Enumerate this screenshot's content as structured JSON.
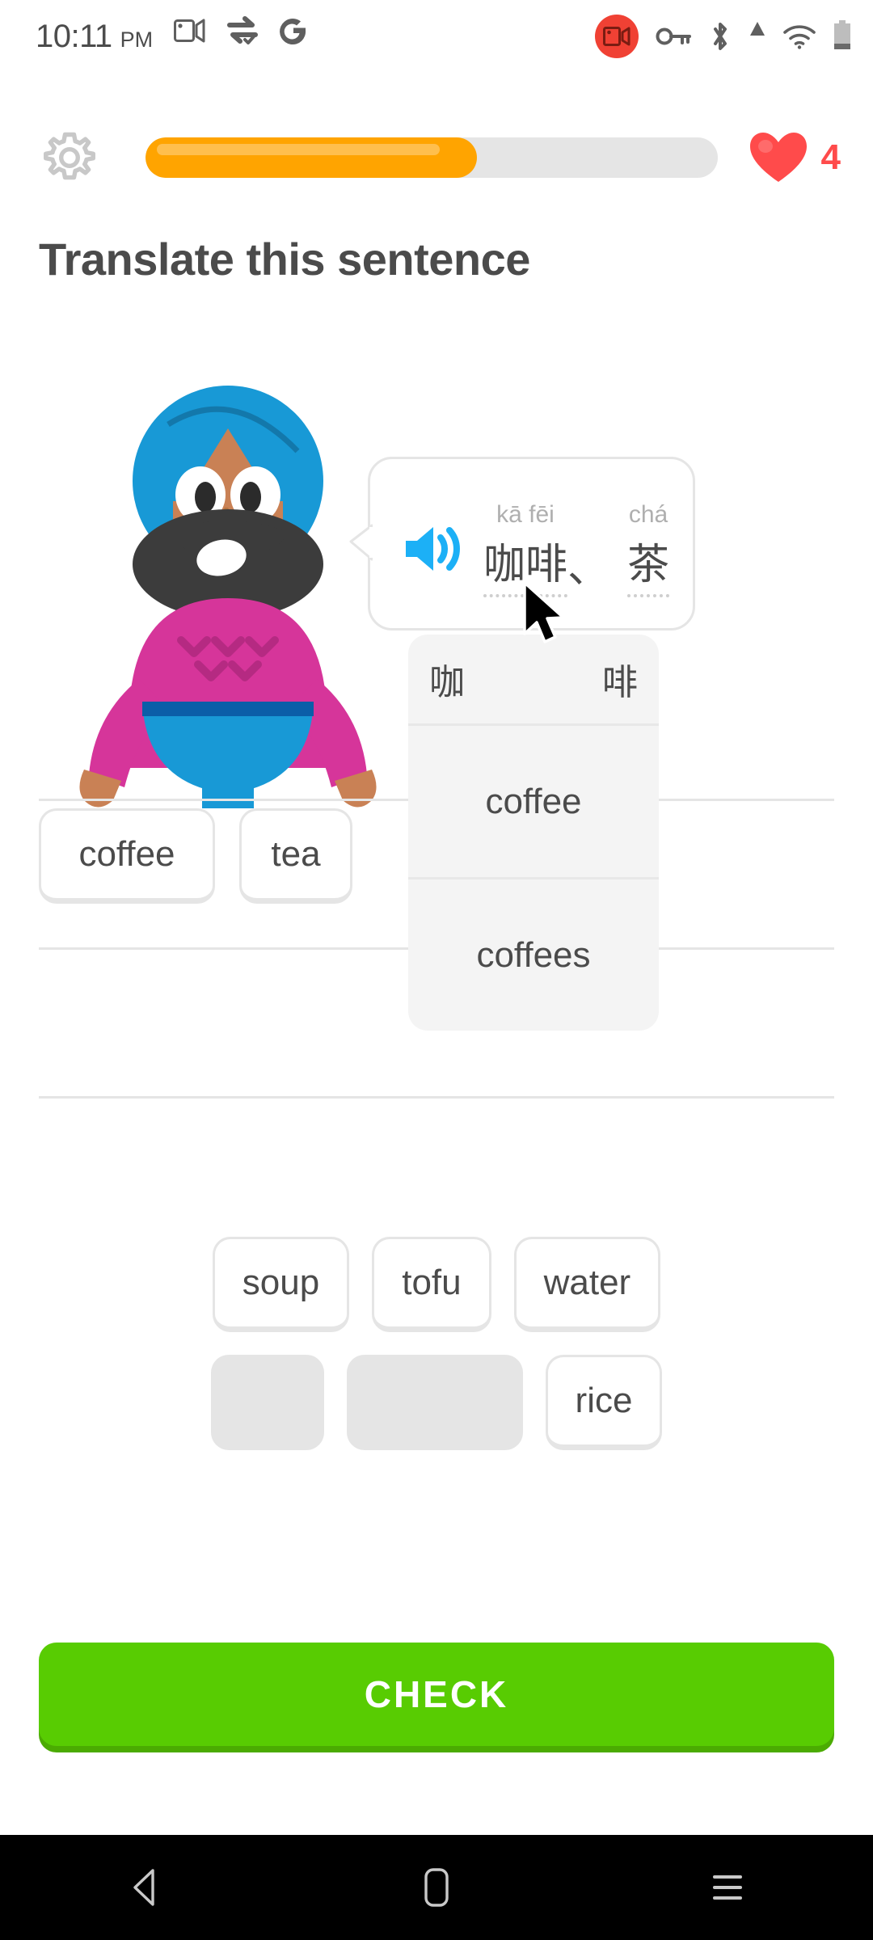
{
  "status_bar": {
    "time": "10:11",
    "ampm": "PM",
    "left_icons": [
      "video-camera-icon",
      "sync-alt-icon",
      "google-g-icon"
    ],
    "right_icons": [
      "screen-recording-icon",
      "vpn-key-icon",
      "bluetooth-icon",
      "signal-triangle-icon",
      "wifi-icon",
      "battery-icon"
    ]
  },
  "header": {
    "settings_icon": "gear-icon",
    "progress_percent": 58,
    "heart_icon": "heart-icon",
    "heart_count": "4",
    "accent_orange": "#ffa400",
    "heart_red": "#ff4b4b"
  },
  "title": "Translate this sentence",
  "character": {
    "name": "vikram-character",
    "turban_color": "#1899d6",
    "skin_color": "#c98155",
    "beard_color": "#3c3c3c",
    "sweater_color": "#d6359a",
    "skirt_color": "#1899d6",
    "belt_color": "#0b5ea8"
  },
  "speech_bubble": {
    "speaker_icon": "speaker-volume-icon",
    "speaker_color": "#1cb0f6",
    "words": [
      {
        "pinyin": "kā fēi",
        "hanzi": "咖啡",
        "underlined": true
      },
      {
        "pinyin": "",
        "hanzi": "、",
        "underlined": false
      },
      {
        "pinyin": "chá",
        "hanzi": "茶",
        "underlined": true
      }
    ]
  },
  "hint_popup": {
    "header_chars": [
      "咖",
      "啡"
    ],
    "options": [
      "coffee",
      "coffees"
    ]
  },
  "answer": {
    "placed_tiles": [
      "coffee",
      "tea"
    ],
    "line_count": 3
  },
  "word_bank": {
    "row1": [
      "soup",
      "tofu",
      "water"
    ],
    "row2": [
      "",
      "",
      "rice"
    ],
    "used_placeholders": 2
  },
  "check_button": {
    "label": "CHECK",
    "color": "#58cc02"
  },
  "nav_bar": {
    "buttons": [
      "back-icon",
      "home-icon",
      "recents-icon"
    ]
  },
  "cursor": "mouse-pointer-icon"
}
